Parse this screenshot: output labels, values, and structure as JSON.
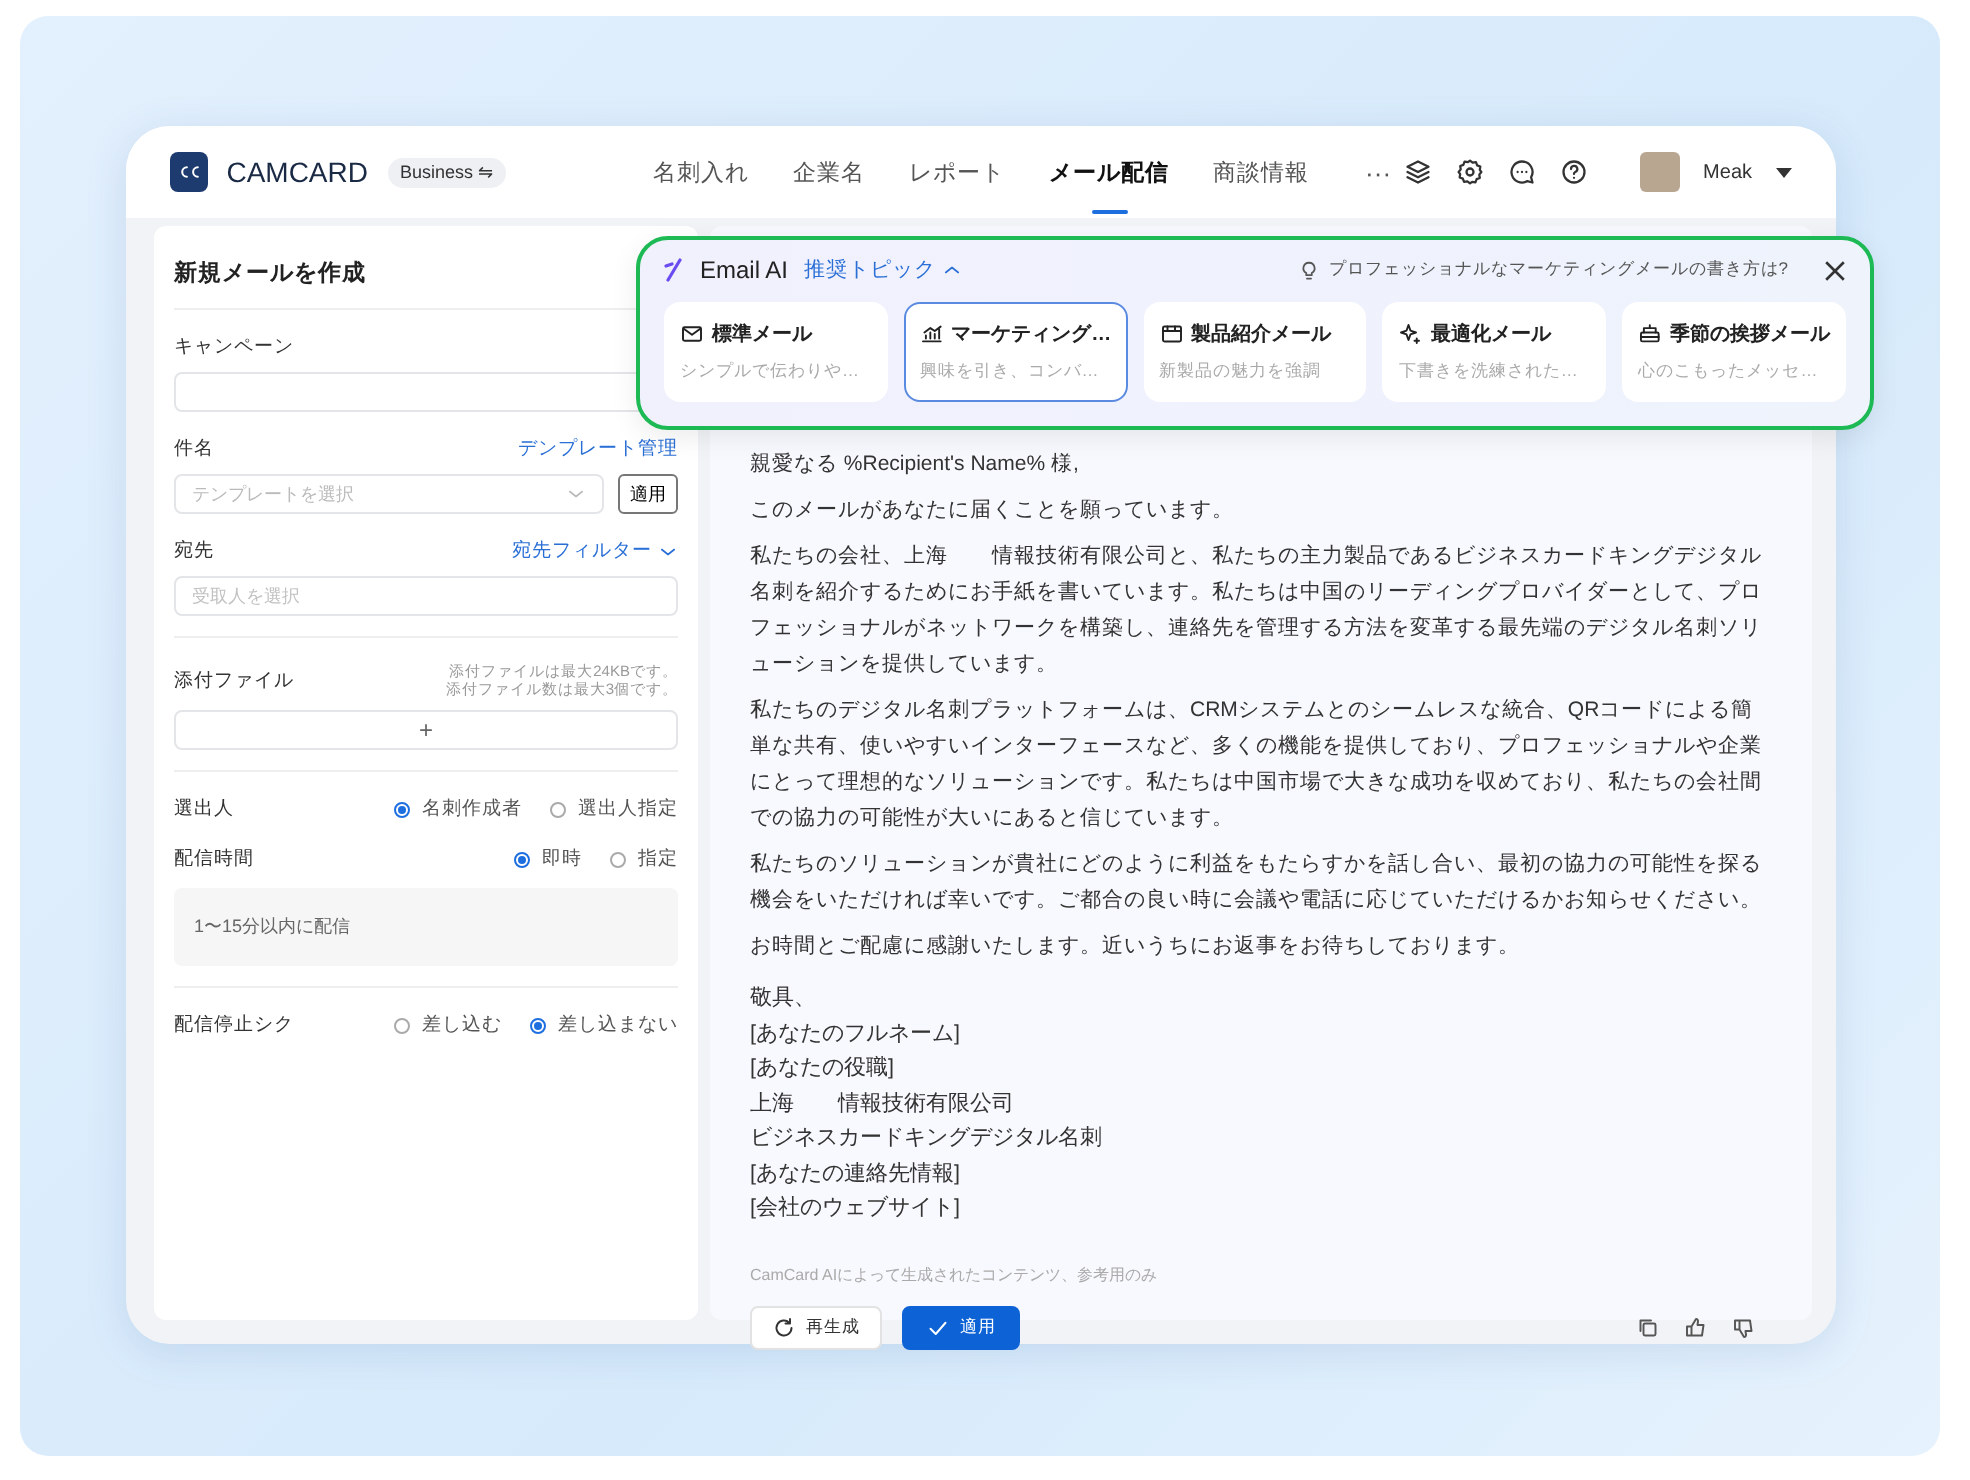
{
  "header": {
    "logo_text": "CAMCARD",
    "plan_badge": "Business ⇋",
    "more": "···",
    "user": "Meak",
    "nav": [
      {
        "label": "名刺入れ",
        "selected": false
      },
      {
        "label": "企業名",
        "selected": false
      },
      {
        "label": "レポート",
        "selected": false
      },
      {
        "label": "メール配信",
        "selected": true
      },
      {
        "label": "商談情報",
        "selected": false
      }
    ]
  },
  "compose": {
    "title": "新規メールを作成",
    "campaign": {
      "label": "キャンペーン"
    },
    "subject": {
      "label": "件名",
      "link": "デンプレート管理",
      "placeholder": "テンプレートを選択",
      "button": "適用"
    },
    "recipient": {
      "label": "宛先",
      "link": "宛先フィルター",
      "placeholder": "受取人を選択"
    },
    "attachment": {
      "label": "添付ファイル",
      "notes": [
        "添付ファイルは最大24KBです。",
        "添付ファイル数は最大3個です。"
      ],
      "add": "+"
    },
    "sender": {
      "label": "選出人",
      "options": [
        {
          "label": "名刺作成者",
          "selected": true
        },
        {
          "label": "選出人指定",
          "selected": false
        }
      ]
    },
    "timing": {
      "label": "配信時間",
      "options": [
        {
          "label": "即時",
          "selected": true
        },
        {
          "label": "指定",
          "selected": false
        }
      ],
      "info": "1〜15分以内に配信"
    },
    "unsubscribe": {
      "label": "配信停止シク",
      "options": [
        {
          "label": "差し込む",
          "selected": false
        },
        {
          "label": "差し込まない",
          "selected": true
        }
      ]
    }
  },
  "ai_panel": {
    "title": "Email AI",
    "topics_link": "推奨トピック",
    "hint": "プロフェッショナルなマーケティングメールの書き方は?",
    "cards": [
      {
        "kind": "mail",
        "title": "標準メール",
        "desc": "シンプルで伝わりや…",
        "selected": false
      },
      {
        "kind": "chart",
        "title": "マーケティング…",
        "desc": "興味を引き、コンバ…",
        "selected": true
      },
      {
        "kind": "product",
        "title": "製品紹介メール",
        "desc": "新製品の魅力を強調",
        "selected": false
      },
      {
        "kind": "sparkle",
        "title": "最適化メール",
        "desc": "下書きを洗練された…",
        "selected": false
      },
      {
        "kind": "gift",
        "title": "季節の挨拶メール",
        "desc": "心のこもったメッセ…",
        "selected": false
      }
    ]
  },
  "email": {
    "paragraphs": [
      "親愛なる %Recipient's Name% 様,",
      "このメールがあなたに届くことを願っています。",
      "私たちの会社、上海　　情報技術有限公司と、私たちの主力製品であるビジネスカードキングデジタル名刺を紹介するためにお手紙を書いています。私たちは中国のリーディングプロバイダーとして、プロフェッショナルがネットワークを構築し、連絡先を管理する方法を変革する最先端のデジタル名刺ソリューションを提供しています。",
      "私たちのデジタル名刺プラットフォームは、CRMシステムとのシームレスな統合、QRコードによる簡単な共有、使いやすいインターフェースなど、多くの機能を提供しており、プロフェッショナルや企業にとって理想的なソリューションです。私たちは中国市場で大きな成功を収めており、私たちの会社間での協力の可能性が大いにあると信じています。",
      "私たちのソリューションが貴社にどのように利益をもたらすかを話し合い、最初の協力の可能性を探る機会をいただければ幸いです。ご都合の良い時に会議や電話に応じていただけるかお知らせください。",
      "お時間とご配慮に感謝いたします。近いうちにお返事をお待ちしております。"
    ],
    "signature": [
      "敬具、",
      "[あなたのフルネーム]",
      "[あなたの役職]",
      "上海　　情報技術有限公司",
      "ビジネスカードキングデジタル名刺",
      "[あなたの連絡先情報]",
      "[会社のウェブサイト]"
    ],
    "disclaimer": "CamCard AIによって生成されたコンテンツ、参考用のみ",
    "regenerate": "再生成",
    "apply": "適用"
  }
}
